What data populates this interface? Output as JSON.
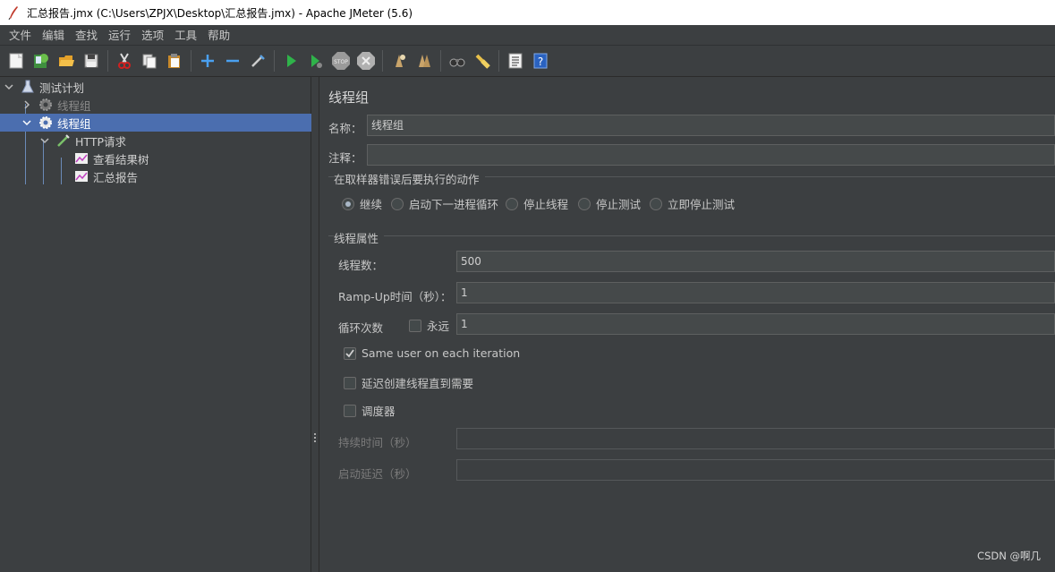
{
  "window": {
    "title": "汇总报告.jmx (C:\\Users\\ZPJX\\Desktop\\汇总报告.jmx) - Apache JMeter (5.6)"
  },
  "menu": [
    "文件",
    "编辑",
    "查找",
    "运行",
    "选项",
    "工具",
    "帮助"
  ],
  "toolbar_icons": [
    "new-icon",
    "templates-icon",
    "open-icon",
    "save-icon",
    "cut-icon",
    "copy-icon",
    "paste-icon",
    "expand-icon",
    "collapse-icon",
    "toggle-icon",
    "start-icon",
    "start-no-pause-icon",
    "stop-icon",
    "shutdown-icon",
    "clear-icon",
    "clear-all-icon",
    "search-icon",
    "reset-search-icon",
    "function-helper-icon",
    "help-icon"
  ],
  "tree": {
    "items": [
      {
        "label": "测试计划",
        "icon": "test-plan-icon"
      },
      {
        "label": "线程组",
        "icon": "gear-icon",
        "disabled": true
      },
      {
        "label": "线程组",
        "icon": "gear-icon",
        "selected": true
      },
      {
        "label": "HTTP请求",
        "icon": "sampler-icon"
      },
      {
        "label": "查看结果树",
        "icon": "listener-icon"
      },
      {
        "label": "汇总报告",
        "icon": "listener-icon"
      }
    ]
  },
  "panel": {
    "title": "线程组",
    "name_label": "名称：",
    "name_value": "线程组",
    "comment_label": "注释：",
    "comment_value": "",
    "error_action": {
      "title": "在取样器错误后要执行的动作",
      "options": [
        "继续",
        "启动下一进程循环",
        "停止线程",
        "停止测试",
        "立即停止测试"
      ],
      "selected": "继续"
    },
    "thread_props": {
      "title": "线程属性",
      "threads_label": "线程数：",
      "threads_value": "500",
      "rampup_label": "Ramp-Up时间（秒）：",
      "rampup_value": "1",
      "loop_label": "循环次数",
      "forever_label": "永远",
      "forever_checked": false,
      "loop_value": "1",
      "same_user_label": "Same user on each iteration",
      "same_user_checked": true,
      "delay_label": "延迟创建线程直到需要",
      "delay_checked": false,
      "scheduler_label": "调度器",
      "scheduler_checked": false,
      "duration_label": "持续时间（秒）",
      "duration_value": "",
      "startup_delay_label": "启动延迟（秒）",
      "startup_delay_value": ""
    }
  },
  "watermark": "CSDN @啊几"
}
